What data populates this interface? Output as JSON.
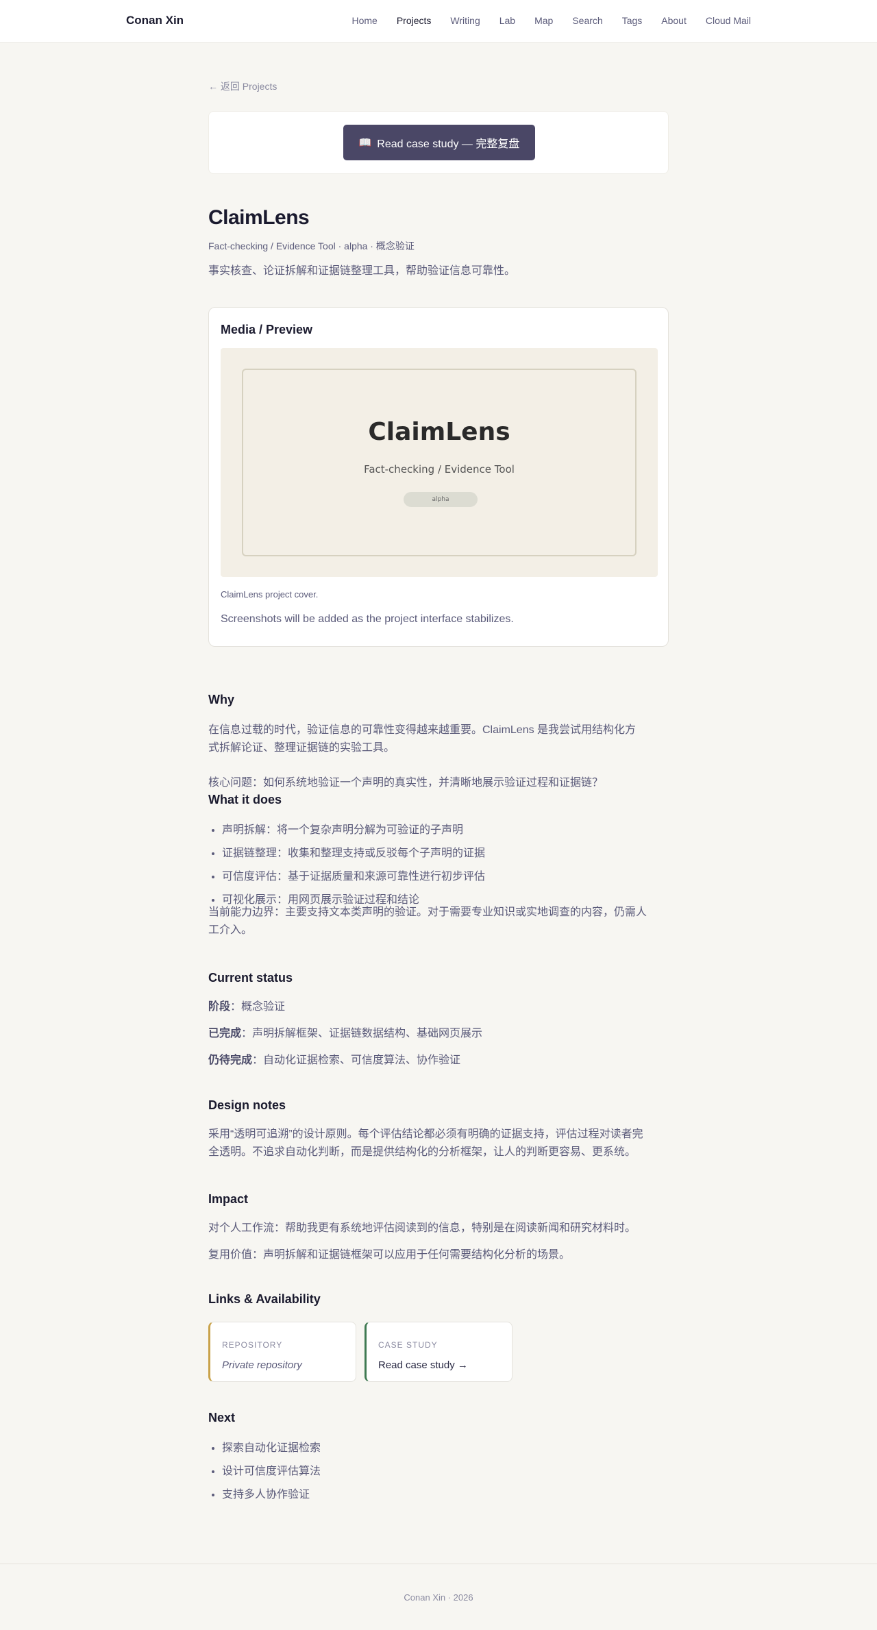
{
  "header": {
    "brand": "Conan Xin",
    "nav": [
      "Home",
      "Projects",
      "Writing",
      "Lab",
      "Map",
      "Search",
      "Tags",
      "About",
      "Cloud Mail"
    ]
  },
  "back_link": "← 返回 Projects",
  "cta": {
    "icon": "📖",
    "label": "Read case study — 完整复盘"
  },
  "project": {
    "title": "ClaimLens",
    "meta": "Fact-checking / Evidence Tool · alpha · 概念验证",
    "tagline": "事实核查、论证拆解和证据链整理工具，帮助验证信息可靠性。"
  },
  "media": {
    "heading": "Media / Preview",
    "cover_title": "ClaimLens",
    "cover_subtitle": "Fact-checking / Evidence Tool",
    "cover_badge": "alpha",
    "caption": "ClaimLens project cover.",
    "note": "Screenshots will be added as the project interface stabilizes."
  },
  "why": {
    "heading": "Why",
    "p1": "在信息过载的时代，验证信息的可靠性变得越来越重要。ClaimLens 是我尝试用结构化方式拆解论证、整理证据链的实验工具。",
    "p2": "核心问题：如何系统地验证一个声明的真实性，并清晰地展示验证过程和证据链？"
  },
  "what": {
    "heading": "What it does",
    "items": [
      "声明拆解：将一个复杂声明分解为可验证的子声明",
      "证据链整理：收集和整理支持或反驳每个子声明的证据",
      "可信度评估：基于证据质量和来源可靠性进行初步评估",
      "可视化展示：用网页展示验证过程和结论"
    ],
    "boundary": "当前能力边界：主要支持文本类声明的验证。对于需要专业知识或实地调查的内容，仍需人工介入。"
  },
  "status": {
    "heading": "Current status",
    "stage_label": "阶段",
    "stage_value": "：概念验证",
    "done_label": "已完成",
    "done_value": "：声明拆解框架、证据链数据结构、基础网页展示",
    "todo_label": "仍待完成",
    "todo_value": "：自动化证据检索、可信度算法、协作验证"
  },
  "design": {
    "heading": "Design notes",
    "p1": "采用“透明可追溯”的设计原则。每个评估结论都必须有明确的证据支持，评估过程对读者完全透明。不追求自动化判断，而是提供结构化的分析框架，让人的判断更容易、更系统。"
  },
  "impact": {
    "heading": "Impact",
    "p1": "对个人工作流：帮助我更有系统地评估阅读到的信息，特别是在阅读新闻和研究材料时。",
    "p2": "复用价值：声明拆解和证据链框架可以应用于任何需要结构化分析的场景。"
  },
  "links": {
    "heading": "Links & Availability",
    "repo_label": "REPOSITORY",
    "repo_value": "Private repository",
    "case_label": "CASE STUDY",
    "case_value": "Read case study →"
  },
  "next": {
    "heading": "Next",
    "items": [
      "探索自动化证据检索",
      "设计可信度评估算法",
      "支持多人协作验证"
    ]
  },
  "footer": "Conan Xin · 2026"
}
